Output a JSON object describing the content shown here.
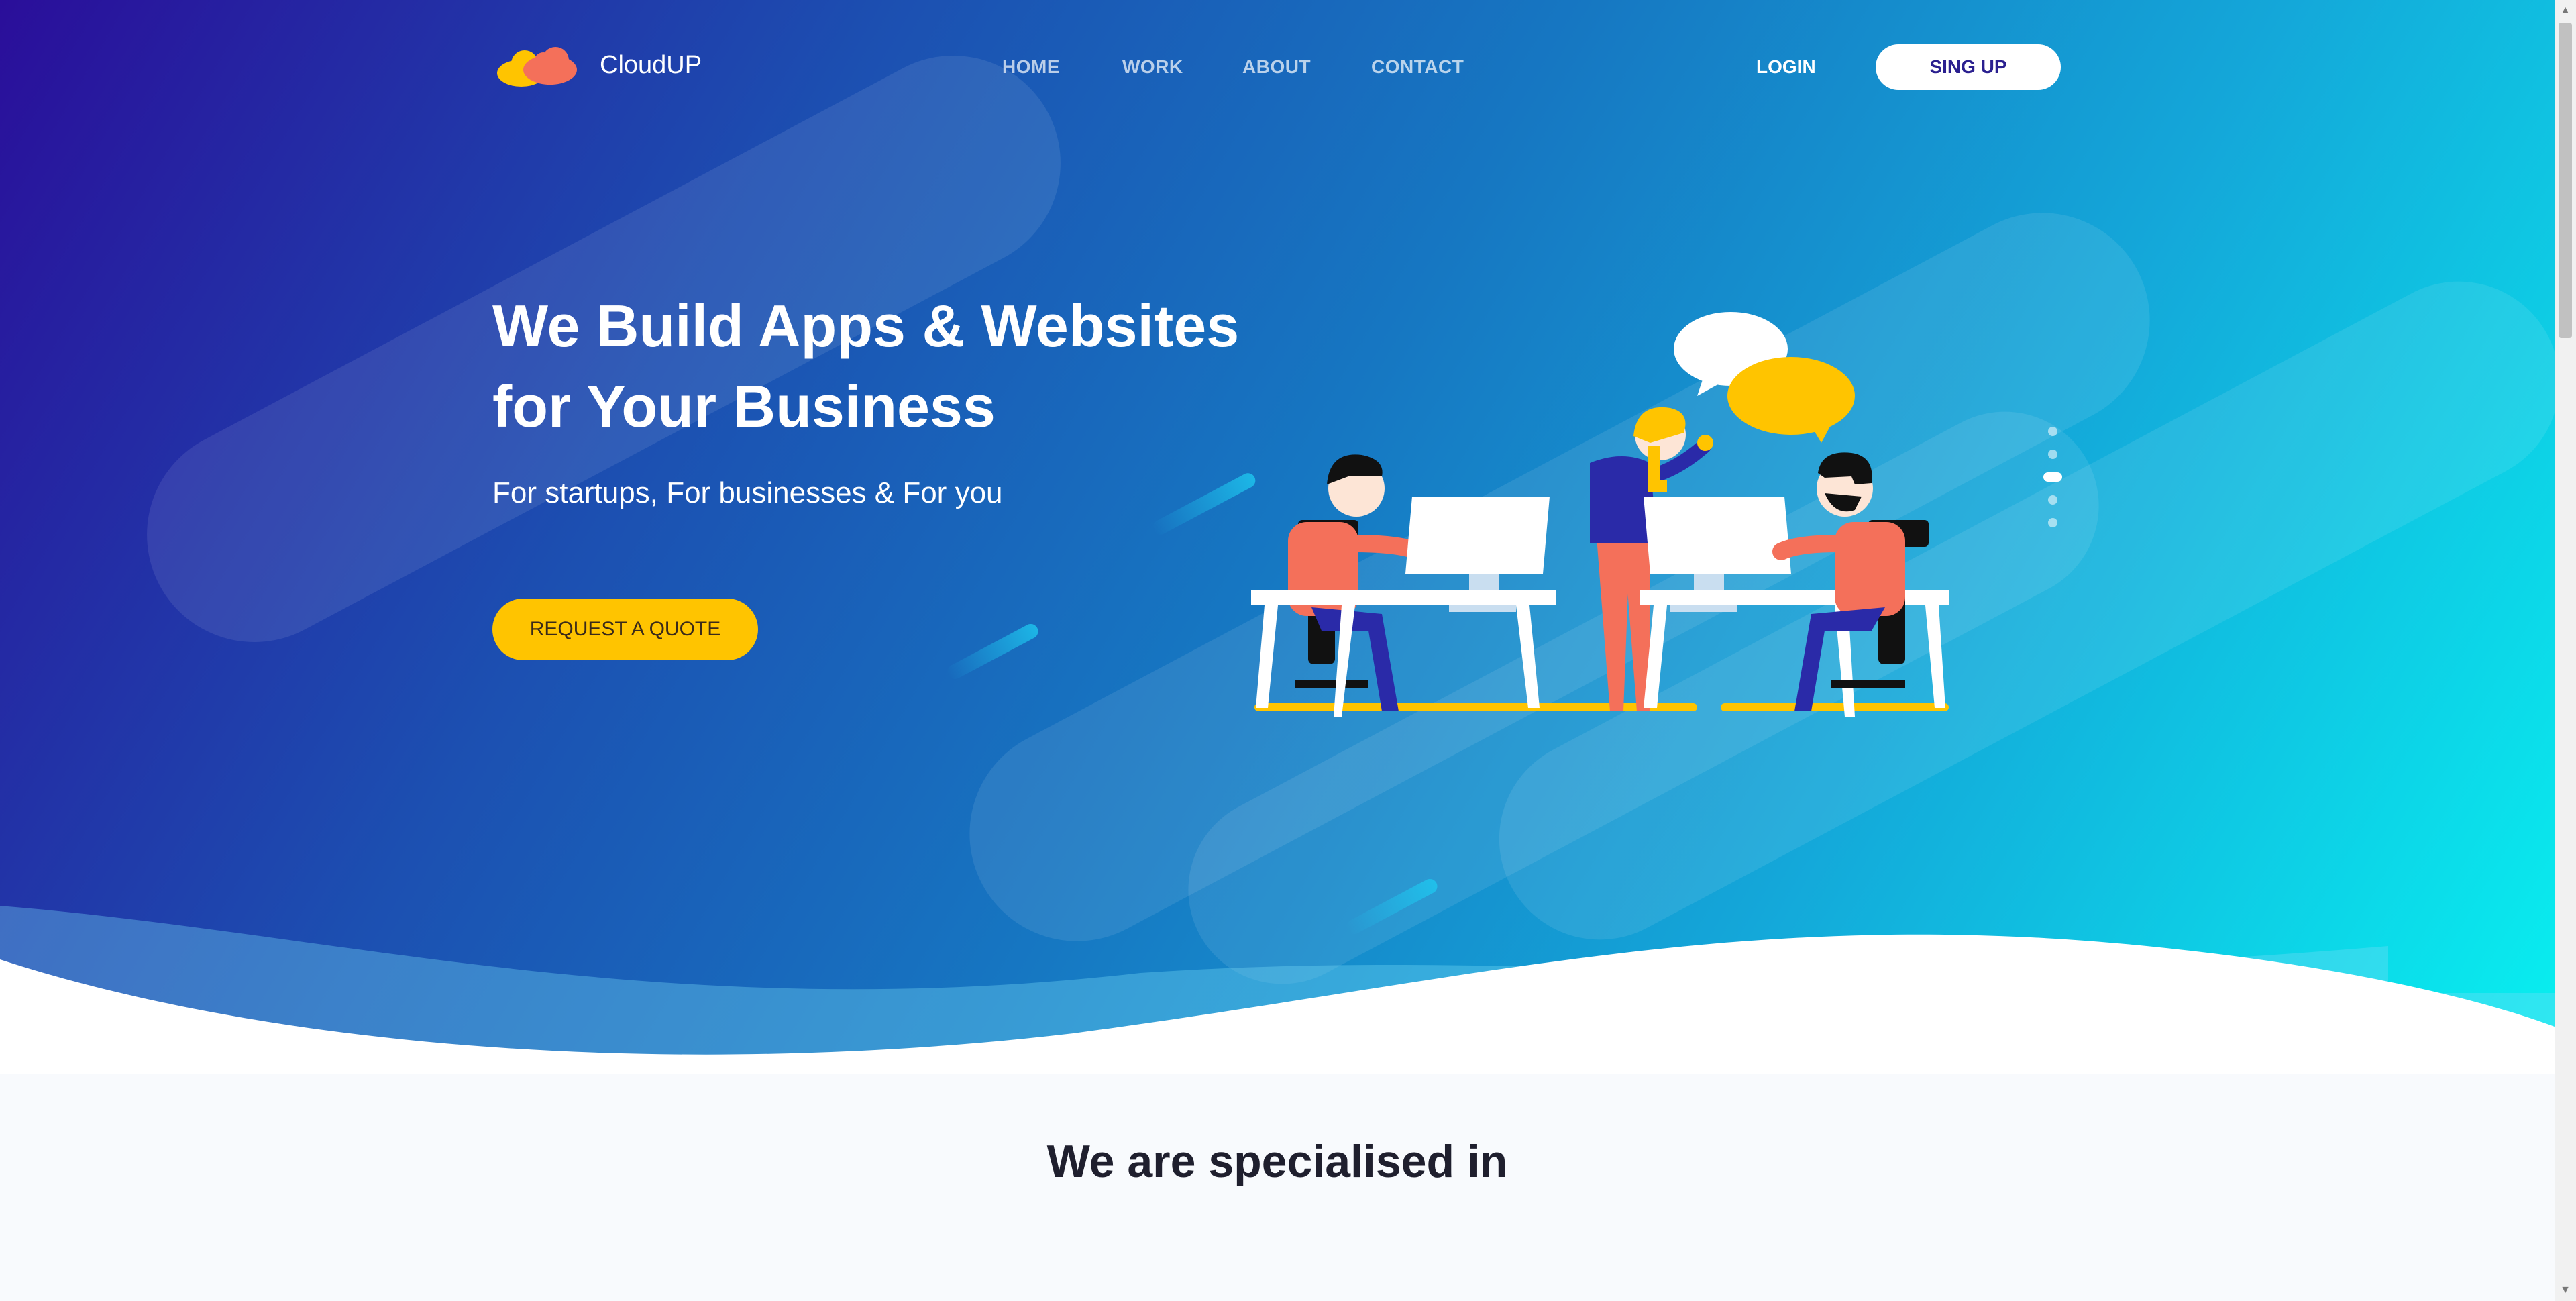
{
  "brand": {
    "name": "CloudUP"
  },
  "nav": {
    "links": [
      "HOME",
      "WORK",
      "ABOUT",
      "CONTACT"
    ],
    "login_label": "LOGIN",
    "signup_label": "SING UP"
  },
  "hero": {
    "headline_line1": "We Build Apps & Websites",
    "headline_line2": "for Your Business",
    "subheadline": "For startups, For businesses & For you",
    "cta_label": "REQUEST A QUOTE",
    "slider_dots": 5,
    "active_dot": 3
  },
  "section": {
    "title": "We are specialised in"
  },
  "colors": {
    "gradient_start": "#2a0e9a",
    "gradient_end": "#08f0f0",
    "accent_yellow": "#ffc400",
    "logo_coral": "#f4705a",
    "text_white": "#ffffff",
    "signup_text": "#2a1f8f"
  },
  "icons": [
    "cloud-logo-icon",
    "scroll-up-arrow-icon",
    "scroll-down-arrow-icon"
  ]
}
